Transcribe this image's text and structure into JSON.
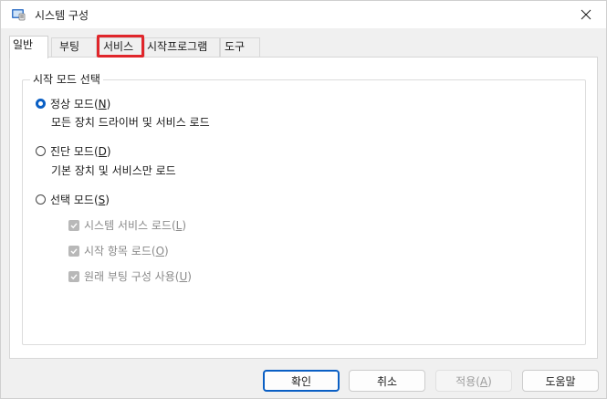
{
  "window": {
    "title": "시스템 구성"
  },
  "tabs": [
    {
      "label": "일반"
    },
    {
      "label": "부팅"
    },
    {
      "label": "서비스"
    },
    {
      "label": "시작프로그램"
    },
    {
      "label": "도구"
    }
  ],
  "group": {
    "label": "시작 모드 선택",
    "modes": [
      {
        "label": "정상 모드(",
        "mnemonic": "N",
        "suffix": ")",
        "description": "모든 장치 드라이버 및 서비스 로드",
        "selected": true
      },
      {
        "label": "진단 모드(",
        "mnemonic": "D",
        "suffix": ")",
        "description": "기본 장치 및 서비스만 로드",
        "selected": false
      },
      {
        "label": "선택 모드(",
        "mnemonic": "S",
        "suffix": ")",
        "selected": false
      }
    ],
    "options": [
      {
        "label": "시스템 서비스 로드(",
        "mnemonic": "L",
        "suffix": ")"
      },
      {
        "label": "시작 항목 로드(",
        "mnemonic": "O",
        "suffix": ")"
      },
      {
        "label": "원래 부팅 구성 사용(",
        "mnemonic": "U",
        "suffix": ")"
      }
    ]
  },
  "buttons": {
    "ok": "확인",
    "cancel": "취소",
    "apply": "적용(",
    "apply_mnemonic": "A",
    "apply_suffix": ")",
    "help": "도움말"
  },
  "colors": {
    "accent": "#0a5fc4",
    "highlight": "#e0262b"
  }
}
